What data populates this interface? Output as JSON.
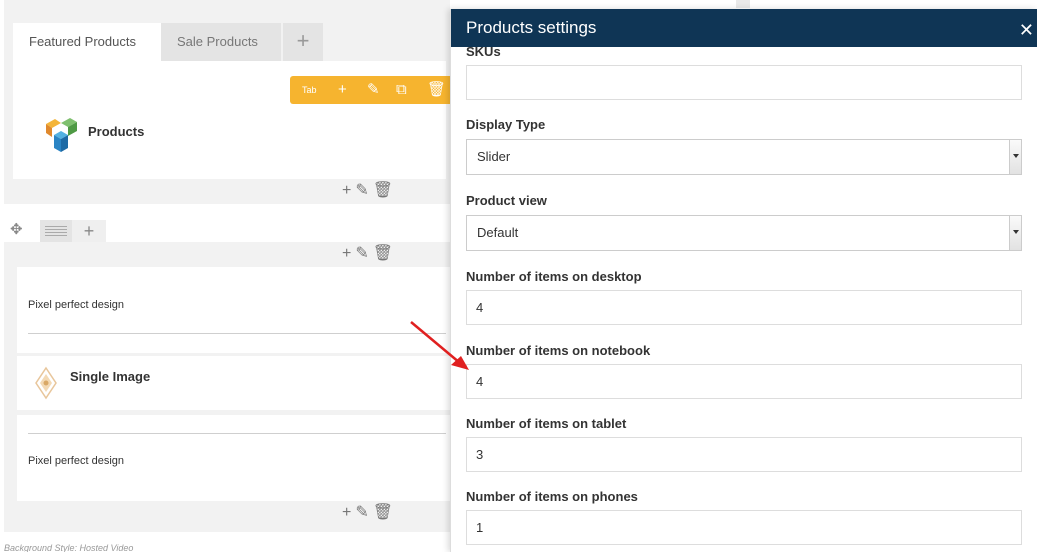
{
  "builder": {
    "tabs": [
      {
        "label": "Featured Products"
      },
      {
        "label": "Sale Products"
      }
    ],
    "tab_add_icon": "plus-icon",
    "tab_toolbar": {
      "label": "Tab",
      "icons": [
        "plus-icon",
        "pencil-icon",
        "copy-icon",
        "trash-icon"
      ]
    },
    "products_element": {
      "label": "Products",
      "icon": "visual-composer-logo-icon"
    },
    "element_controls": [
      "plus-icon",
      "pencil-icon",
      "trash-icon"
    ],
    "row_controls": [
      "move-icon",
      "columns-icon",
      "plus-icon"
    ],
    "elements": [
      {
        "text": "Pixel perfect design"
      },
      {
        "label": "Single Image",
        "icon": "single-image-icon"
      },
      {
        "text": "Pixel perfect design"
      }
    ],
    "background_style": "Background Style: Hosted Video"
  },
  "modal": {
    "title": "Products settings",
    "close_icon": "close-icon",
    "fields": [
      {
        "label": "SKUs",
        "value": ""
      },
      {
        "label": "Display Type",
        "value": "Slider",
        "type": "select"
      },
      {
        "label": "Product view",
        "value": "Default",
        "type": "select"
      },
      {
        "label": "Number of items on desktop",
        "value": "4"
      },
      {
        "label": "Number of items on notebook",
        "value": "4"
      },
      {
        "label": "Number of items on tablet",
        "value": "3"
      },
      {
        "label": "Number of items on phones",
        "value": "1"
      }
    ]
  },
  "annotation": {
    "arrow_color": "#e02020"
  },
  "colors": {
    "modal_header": "#0f3555",
    "tab_toolbar": "#f6b42f",
    "builder_bg": "#f2f2f2"
  }
}
